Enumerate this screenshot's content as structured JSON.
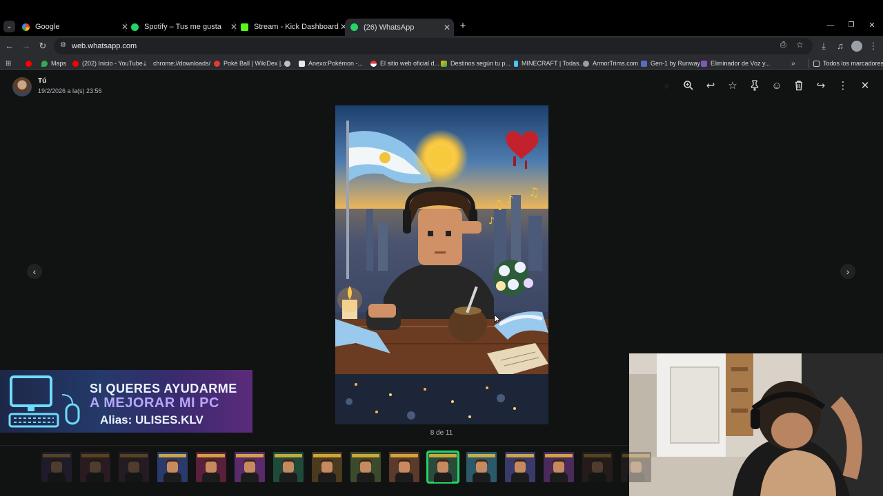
{
  "browser": {
    "tabs": [
      {
        "label": "Google",
        "icon": "google-icon",
        "color": "#4285f4"
      },
      {
        "label": "Spotify – Tus me gusta",
        "icon": "spotify-icon",
        "color": "#1ed760"
      },
      {
        "label": "Stream - Kick Dashboard",
        "icon": "kick-icon",
        "color": "#53fc18"
      },
      {
        "label": "(26) WhatsApp",
        "icon": "whatsapp-icon",
        "color": "#25d366",
        "active": true
      }
    ],
    "url": "web.whatsapp.com",
    "bookmarks": [
      {
        "label": "Maps",
        "icon": "maps-icon"
      },
      {
        "label": "(202) Inicio - YouTube",
        "icon": "youtube-icon"
      },
      {
        "label": "chrome://downloads/",
        "icon": "download-icon"
      },
      {
        "label": "Poké Ball | WikiDex |...",
        "icon": "wikidex-icon"
      },
      {
        "label": "",
        "icon": "globe-icon"
      },
      {
        "label": "Anexo:Pokémon -...",
        "icon": "wikipedia-icon"
      },
      {
        "label": "El sitio web oficial d...",
        "icon": "pokemon-icon"
      },
      {
        "label": "Destinos según tu p...",
        "icon": "destinos-icon"
      },
      {
        "label": "MINECRAFT | Todas...",
        "icon": "minecraft-icon"
      },
      {
        "label": "ArmorTrims.com",
        "icon": "armortrims-icon"
      },
      {
        "label": "Gen-1 by Runway",
        "icon": "runway-icon"
      },
      {
        "label": "Eliminador de Voz y...",
        "icon": "voice-icon"
      }
    ],
    "all_bookmarks": "Todos los marcadores"
  },
  "viewer": {
    "sender": "Tú",
    "timestamp": "19/2/2026 a la(s) 23:56",
    "counter": "8 de 11",
    "thumbnail_count": 16,
    "active_thumbnail": 10
  },
  "overlay": {
    "donation_line1": "SI QUERES AYUDARME",
    "donation_line2": "A MEJORAR MI PC",
    "donation_line3": "Alias: ULISES.KLV"
  }
}
